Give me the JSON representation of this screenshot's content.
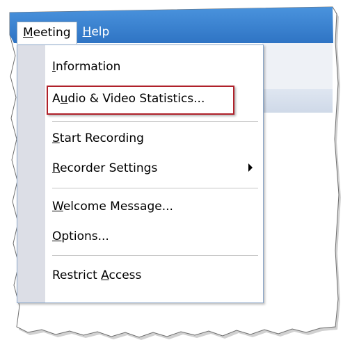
{
  "colors": {
    "titlebar_blue": "#3a82d0",
    "highlight_border": "#b0202a",
    "menu_gutter": "#dcdee6"
  },
  "menubar": {
    "items": [
      {
        "label": "Meeting",
        "mnemonic": "M",
        "rest": "eeting"
      },
      {
        "label": "Help",
        "mnemonic": "H",
        "rest": "elp"
      }
    ]
  },
  "menu": {
    "items": [
      {
        "label": "Information",
        "pre": "",
        "mnemonic": "I",
        "post": "nformation"
      },
      {
        "label": "Audio & Video Statistics...",
        "pre": "A",
        "mnemonic": "u",
        "post": "dio & Video Statistics..."
      },
      {
        "label": "Start Recording",
        "pre": "",
        "mnemonic": "S",
        "post": "tart Recording"
      },
      {
        "label": "Recorder Settings",
        "pre": "",
        "mnemonic": "R",
        "post": "ecorder Settings",
        "submenu_icon": "submenu-arrow-icon"
      },
      {
        "label": "Welcome Message...",
        "pre": "",
        "mnemonic": "W",
        "post": "elcome Message..."
      },
      {
        "label": "Options...",
        "pre": "",
        "mnemonic": "O",
        "post": "ptions..."
      },
      {
        "label": "Restrict Access",
        "pre": "Restrict ",
        "mnemonic": "A",
        "post": "ccess"
      }
    ]
  }
}
